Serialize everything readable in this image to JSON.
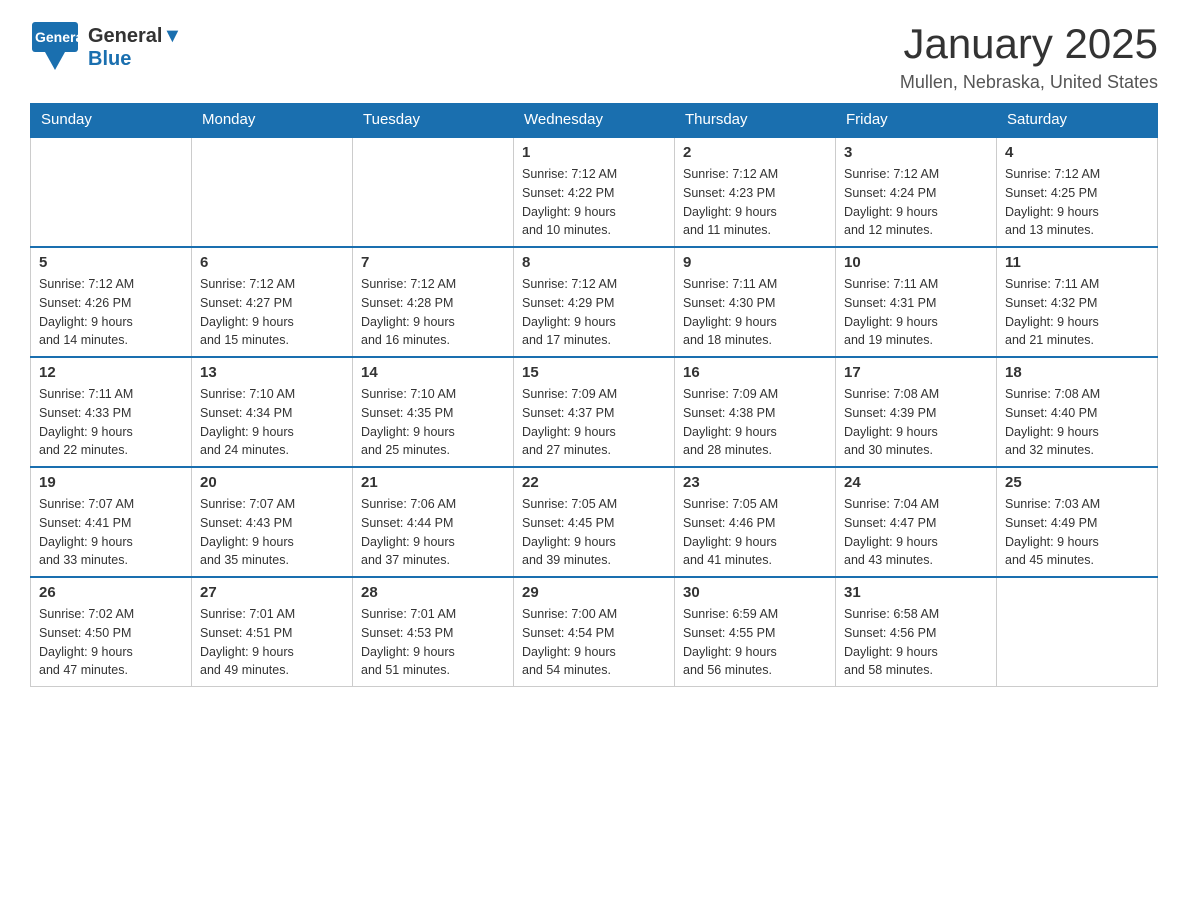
{
  "header": {
    "logo_general": "General",
    "logo_blue": "Blue",
    "month_title": "January 2025",
    "location": "Mullen, Nebraska, United States"
  },
  "days_of_week": [
    "Sunday",
    "Monday",
    "Tuesday",
    "Wednesday",
    "Thursday",
    "Friday",
    "Saturday"
  ],
  "weeks": [
    [
      {
        "day": "",
        "info": ""
      },
      {
        "day": "",
        "info": ""
      },
      {
        "day": "",
        "info": ""
      },
      {
        "day": "1",
        "info": "Sunrise: 7:12 AM\nSunset: 4:22 PM\nDaylight: 9 hours\nand 10 minutes."
      },
      {
        "day": "2",
        "info": "Sunrise: 7:12 AM\nSunset: 4:23 PM\nDaylight: 9 hours\nand 11 minutes."
      },
      {
        "day": "3",
        "info": "Sunrise: 7:12 AM\nSunset: 4:24 PM\nDaylight: 9 hours\nand 12 minutes."
      },
      {
        "day": "4",
        "info": "Sunrise: 7:12 AM\nSunset: 4:25 PM\nDaylight: 9 hours\nand 13 minutes."
      }
    ],
    [
      {
        "day": "5",
        "info": "Sunrise: 7:12 AM\nSunset: 4:26 PM\nDaylight: 9 hours\nand 14 minutes."
      },
      {
        "day": "6",
        "info": "Sunrise: 7:12 AM\nSunset: 4:27 PM\nDaylight: 9 hours\nand 15 minutes."
      },
      {
        "day": "7",
        "info": "Sunrise: 7:12 AM\nSunset: 4:28 PM\nDaylight: 9 hours\nand 16 minutes."
      },
      {
        "day": "8",
        "info": "Sunrise: 7:12 AM\nSunset: 4:29 PM\nDaylight: 9 hours\nand 17 minutes."
      },
      {
        "day": "9",
        "info": "Sunrise: 7:11 AM\nSunset: 4:30 PM\nDaylight: 9 hours\nand 18 minutes."
      },
      {
        "day": "10",
        "info": "Sunrise: 7:11 AM\nSunset: 4:31 PM\nDaylight: 9 hours\nand 19 minutes."
      },
      {
        "day": "11",
        "info": "Sunrise: 7:11 AM\nSunset: 4:32 PM\nDaylight: 9 hours\nand 21 minutes."
      }
    ],
    [
      {
        "day": "12",
        "info": "Sunrise: 7:11 AM\nSunset: 4:33 PM\nDaylight: 9 hours\nand 22 minutes."
      },
      {
        "day": "13",
        "info": "Sunrise: 7:10 AM\nSunset: 4:34 PM\nDaylight: 9 hours\nand 24 minutes."
      },
      {
        "day": "14",
        "info": "Sunrise: 7:10 AM\nSunset: 4:35 PM\nDaylight: 9 hours\nand 25 minutes."
      },
      {
        "day": "15",
        "info": "Sunrise: 7:09 AM\nSunset: 4:37 PM\nDaylight: 9 hours\nand 27 minutes."
      },
      {
        "day": "16",
        "info": "Sunrise: 7:09 AM\nSunset: 4:38 PM\nDaylight: 9 hours\nand 28 minutes."
      },
      {
        "day": "17",
        "info": "Sunrise: 7:08 AM\nSunset: 4:39 PM\nDaylight: 9 hours\nand 30 minutes."
      },
      {
        "day": "18",
        "info": "Sunrise: 7:08 AM\nSunset: 4:40 PM\nDaylight: 9 hours\nand 32 minutes."
      }
    ],
    [
      {
        "day": "19",
        "info": "Sunrise: 7:07 AM\nSunset: 4:41 PM\nDaylight: 9 hours\nand 33 minutes."
      },
      {
        "day": "20",
        "info": "Sunrise: 7:07 AM\nSunset: 4:43 PM\nDaylight: 9 hours\nand 35 minutes."
      },
      {
        "day": "21",
        "info": "Sunrise: 7:06 AM\nSunset: 4:44 PM\nDaylight: 9 hours\nand 37 minutes."
      },
      {
        "day": "22",
        "info": "Sunrise: 7:05 AM\nSunset: 4:45 PM\nDaylight: 9 hours\nand 39 minutes."
      },
      {
        "day": "23",
        "info": "Sunrise: 7:05 AM\nSunset: 4:46 PM\nDaylight: 9 hours\nand 41 minutes."
      },
      {
        "day": "24",
        "info": "Sunrise: 7:04 AM\nSunset: 4:47 PM\nDaylight: 9 hours\nand 43 minutes."
      },
      {
        "day": "25",
        "info": "Sunrise: 7:03 AM\nSunset: 4:49 PM\nDaylight: 9 hours\nand 45 minutes."
      }
    ],
    [
      {
        "day": "26",
        "info": "Sunrise: 7:02 AM\nSunset: 4:50 PM\nDaylight: 9 hours\nand 47 minutes."
      },
      {
        "day": "27",
        "info": "Sunrise: 7:01 AM\nSunset: 4:51 PM\nDaylight: 9 hours\nand 49 minutes."
      },
      {
        "day": "28",
        "info": "Sunrise: 7:01 AM\nSunset: 4:53 PM\nDaylight: 9 hours\nand 51 minutes."
      },
      {
        "day": "29",
        "info": "Sunrise: 7:00 AM\nSunset: 4:54 PM\nDaylight: 9 hours\nand 54 minutes."
      },
      {
        "day": "30",
        "info": "Sunrise: 6:59 AM\nSunset: 4:55 PM\nDaylight: 9 hours\nand 56 minutes."
      },
      {
        "day": "31",
        "info": "Sunrise: 6:58 AM\nSunset: 4:56 PM\nDaylight: 9 hours\nand 58 minutes."
      },
      {
        "day": "",
        "info": ""
      }
    ]
  ]
}
